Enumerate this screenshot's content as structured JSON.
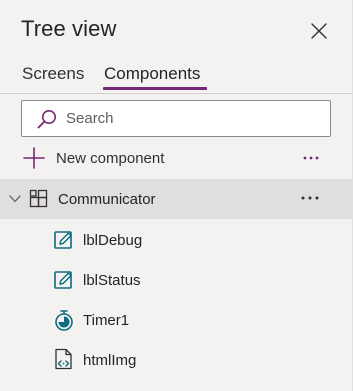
{
  "panel": {
    "title": "Tree view",
    "close_icon": "close-icon"
  },
  "tabs": [
    {
      "label": "Screens",
      "active": false
    },
    {
      "label": "Components",
      "active": true
    }
  ],
  "search": {
    "placeholder": "Search",
    "value": ""
  },
  "new_component": {
    "label": "New component",
    "icon": "plus-icon",
    "more_icon": "more-options-icon"
  },
  "tree": {
    "root": {
      "label": "Communicator",
      "icon": "component-icon",
      "expanded": true,
      "selected": true
    },
    "children": [
      {
        "label": "lblDebug",
        "icon": "label-edit-icon"
      },
      {
        "label": "lblStatus",
        "icon": "label-edit-icon"
      },
      {
        "label": "Timer1",
        "icon": "timer-icon"
      },
      {
        "label": "htmlImg",
        "icon": "html-text-icon"
      }
    ]
  },
  "colors": {
    "accent": "#742774",
    "panel_bg": "#f3f2f1",
    "selected_row": "#e1dfdd",
    "icon_teal": "#0f6c7c",
    "text": "#252423"
  }
}
